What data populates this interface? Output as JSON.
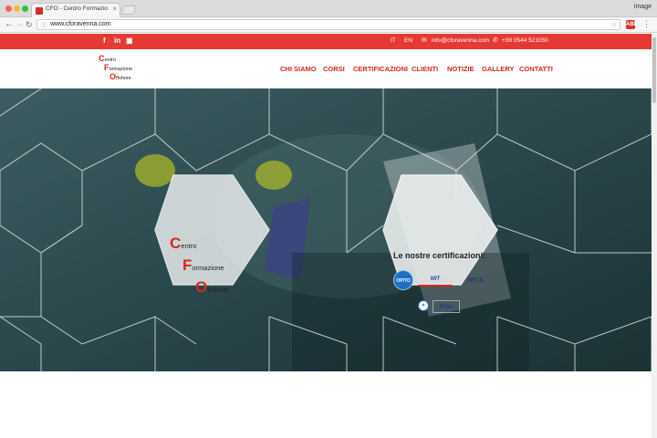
{
  "browser": {
    "tab_title": "CFO - Centro Formazione Offshore",
    "tab_close": "×",
    "profile_label": "image",
    "url": "www.cforavenna.com",
    "back_icon": "←",
    "forward_icon": "→",
    "reload_icon": "↻",
    "info_icon": "ⓘ",
    "star_icon": "☆",
    "extension_label": "ABP",
    "menu_icon": "⋮"
  },
  "topbar": {
    "social": {
      "facebook": "f",
      "linkedin": "in",
      "youtube": "▣"
    },
    "languages": [
      "IT",
      "EN"
    ],
    "email_icon": "✉",
    "email": "info@cforavenna.com",
    "phone_icon": "✆",
    "phone": "+39 0544 521050",
    "color": "#e53a33"
  },
  "logo": {
    "lines": [
      {
        "initial": "C",
        "rest": "entro"
      },
      {
        "initial": "F",
        "rest": "ormazione"
      },
      {
        "initial": "O",
        "rest": "ffshore"
      }
    ]
  },
  "nav": {
    "items": [
      "CHI SIAMO",
      "CORSI",
      "CERTIFICAZIONI",
      "CLIENTI",
      "NOTIZIE",
      "GALLERY",
      "CONTATTI"
    ],
    "color": "#d9261c"
  },
  "hero": {
    "brand_lines": [
      {
        "initial": "C",
        "rest": "entro"
      },
      {
        "initial": "F",
        "rest": "ormazione"
      },
      {
        "initial": "O",
        "rest": "ffshore"
      }
    ],
    "certifications_title": "Le nostre certificazioni:",
    "cert_logos": {
      "opito": "OPITO",
      "mit": "MIT",
      "imca": "IMCA",
      "seal": "✦",
      "rina": "RINA"
    }
  }
}
